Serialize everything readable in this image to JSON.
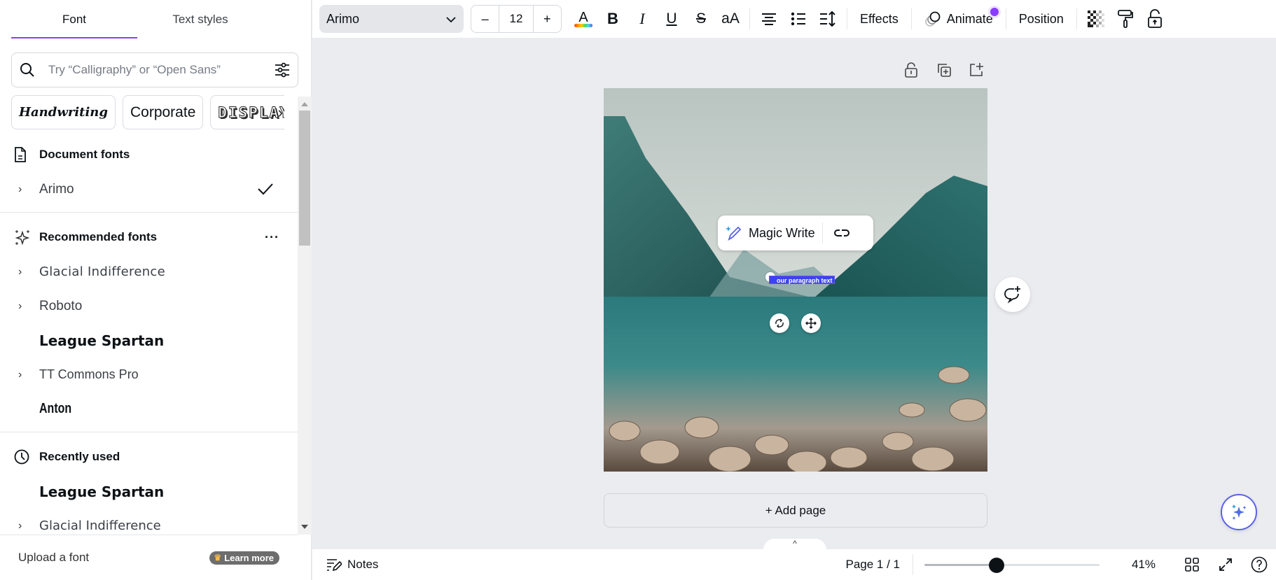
{
  "left_panel": {
    "tabs": [
      {
        "label": "Font",
        "active": true
      },
      {
        "label": "Text styles",
        "active": false
      }
    ],
    "search": {
      "placeholder": "Try “Calligraphy” or “Open Sans”",
      "value": "",
      "icon": "search-icon",
      "filter_icon": "sliders-icon"
    },
    "categories": [
      {
        "label": "Handwriting"
      },
      {
        "label": "Corporate"
      },
      {
        "label": "DISPLAY"
      }
    ],
    "sections": {
      "document": {
        "title": "Document fonts",
        "icon": "document-icon",
        "fonts": [
          {
            "name": "Arimo",
            "expandable": true,
            "selected": true
          }
        ]
      },
      "recommended": {
        "title": "Recommended fonts",
        "icon": "sparkles-icon",
        "more": "···",
        "fonts": [
          {
            "name": "Glacial Indifference",
            "expandable": true
          },
          {
            "name": "Roboto",
            "expandable": true
          },
          {
            "name": "League Spartan",
            "expandable": false
          },
          {
            "name": "TT Commons Pro",
            "expandable": true
          },
          {
            "name": "Anton",
            "expandable": false
          }
        ]
      },
      "recent": {
        "title": "Recently used",
        "icon": "clock-icon",
        "fonts": [
          {
            "name": "League Spartan",
            "expandable": false
          },
          {
            "name": "Glacial Indifference",
            "expandable": true
          }
        ]
      }
    },
    "upload": {
      "label": "Upload a font",
      "learn_more": "Learn more"
    }
  },
  "toolbar": {
    "font_family": "Arimo",
    "font_size": "12",
    "decrease": "–",
    "increase": "+",
    "text_color_letter": "A",
    "bold": "B",
    "italic": "I",
    "underline": "U",
    "strikethrough": "S",
    "case": "aA",
    "effects": "Effects",
    "animate": "Animate",
    "position": "Position"
  },
  "canvas": {
    "magic_write": "Magic Write",
    "selected_text": "our paragraph text",
    "add_page": "+ Add page",
    "collapse": "^"
  },
  "footer": {
    "notes": "Notes",
    "page_indicator": "Page 1 / 1",
    "zoom_value": "41%",
    "zoom_slider_fraction": 0.41
  },
  "colors": {
    "accent": "#8b3dff",
    "selection": "#3b44e8",
    "text": "#0d1216"
  }
}
